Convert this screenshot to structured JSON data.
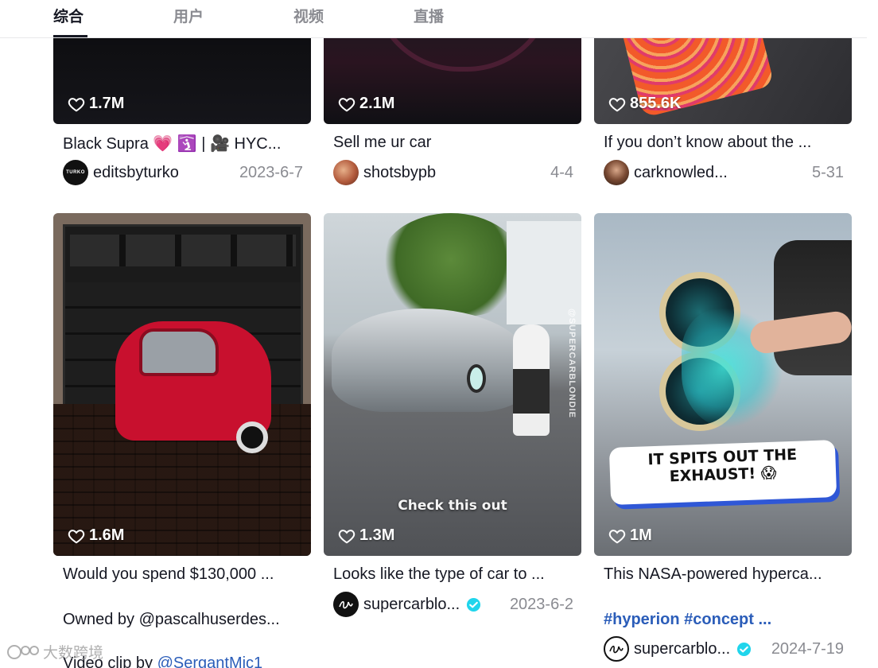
{
  "tabs": [
    {
      "label": "综合",
      "active": true
    },
    {
      "label": "用户",
      "active": false
    },
    {
      "label": "视频",
      "active": false
    },
    {
      "label": "直播",
      "active": false
    }
  ],
  "cards": [
    {
      "likes": "1.7M",
      "title": "Black Supra 💗 🛐 | 🎥 HYC...",
      "author": "editsbyturko",
      "avatar_text": "TURKO",
      "date": "2023-6-7"
    },
    {
      "likes": "2.1M",
      "title": "Sell me ur car",
      "author": "shotsbypb",
      "date": "4-4"
    },
    {
      "likes": "855.6K",
      "title": "If you don’t know about the ...",
      "author": "carknowled...",
      "date": "5-31"
    },
    {
      "likes": "1.6M",
      "title": "Would you spend $130,000 ...",
      "line2": "Owned by @pascalhuserdes...",
      "line3_prefix": "Video clip by ",
      "line3_mention": "@SergantMic1"
    },
    {
      "likes": "1.3M",
      "title": "Looks like the type of car to ...",
      "author": "supercarblo...",
      "verified": true,
      "date": "2023-6-2",
      "overlay": "Check this out",
      "side_text": "@SUPERCARBLONDIE"
    },
    {
      "likes": "1M",
      "title": "This NASA-powered hyperca...",
      "hashtags": "#hyperion #concept ...",
      "author": "supercarblo...",
      "verified": true,
      "date": "2024-7-19",
      "overlay_line1": "IT SPITS OUT THE",
      "overlay_line2": "EXHAUST! 😱"
    }
  ],
  "watermark": "大数跨境"
}
